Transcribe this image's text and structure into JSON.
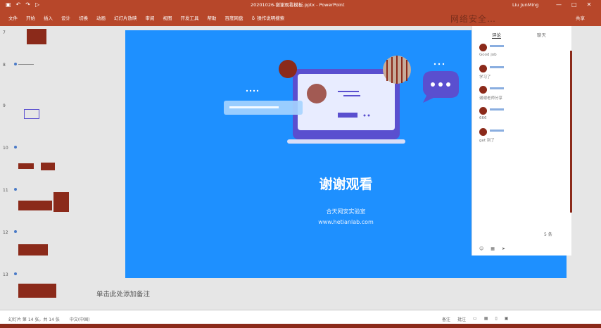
{
  "window": {
    "title": "20201026-谢谢观看模板.pptx - PowerPoint",
    "user": "Liu JunMing",
    "controls": [
      "—",
      "□",
      "✕"
    ]
  },
  "ribbon": {
    "tabs": [
      "文件",
      "开始",
      "插入",
      "设计",
      "切换",
      "动画",
      "幻灯片放映",
      "审阅",
      "视图",
      "开发工具",
      "帮助",
      "百度网盘"
    ],
    "tell_me": "操作说明搜索",
    "share": "共享"
  },
  "thumbnails": {
    "numbers": [
      "7",
      "8",
      "9",
      "10",
      "11",
      "12",
      "13"
    ]
  },
  "slide": {
    "title": "谢谢观看",
    "org": "合天网安实验室",
    "url": "www.hetianlab.com"
  },
  "notes_hint": "单击此处添加备注",
  "chat": {
    "tabs": [
      "评论",
      "聊天"
    ],
    "messages": [
      "Good job",
      "学习了",
      "谢谢老师分享",
      "666",
      "get 到了"
    ],
    "count": "5 条"
  },
  "watermark": "网络安全…",
  "statusbar": {
    "left": [
      "幻灯片 第 14 张，共 14 张",
      "中文(中国)"
    ],
    "right": [
      "备注",
      "批注"
    ]
  }
}
